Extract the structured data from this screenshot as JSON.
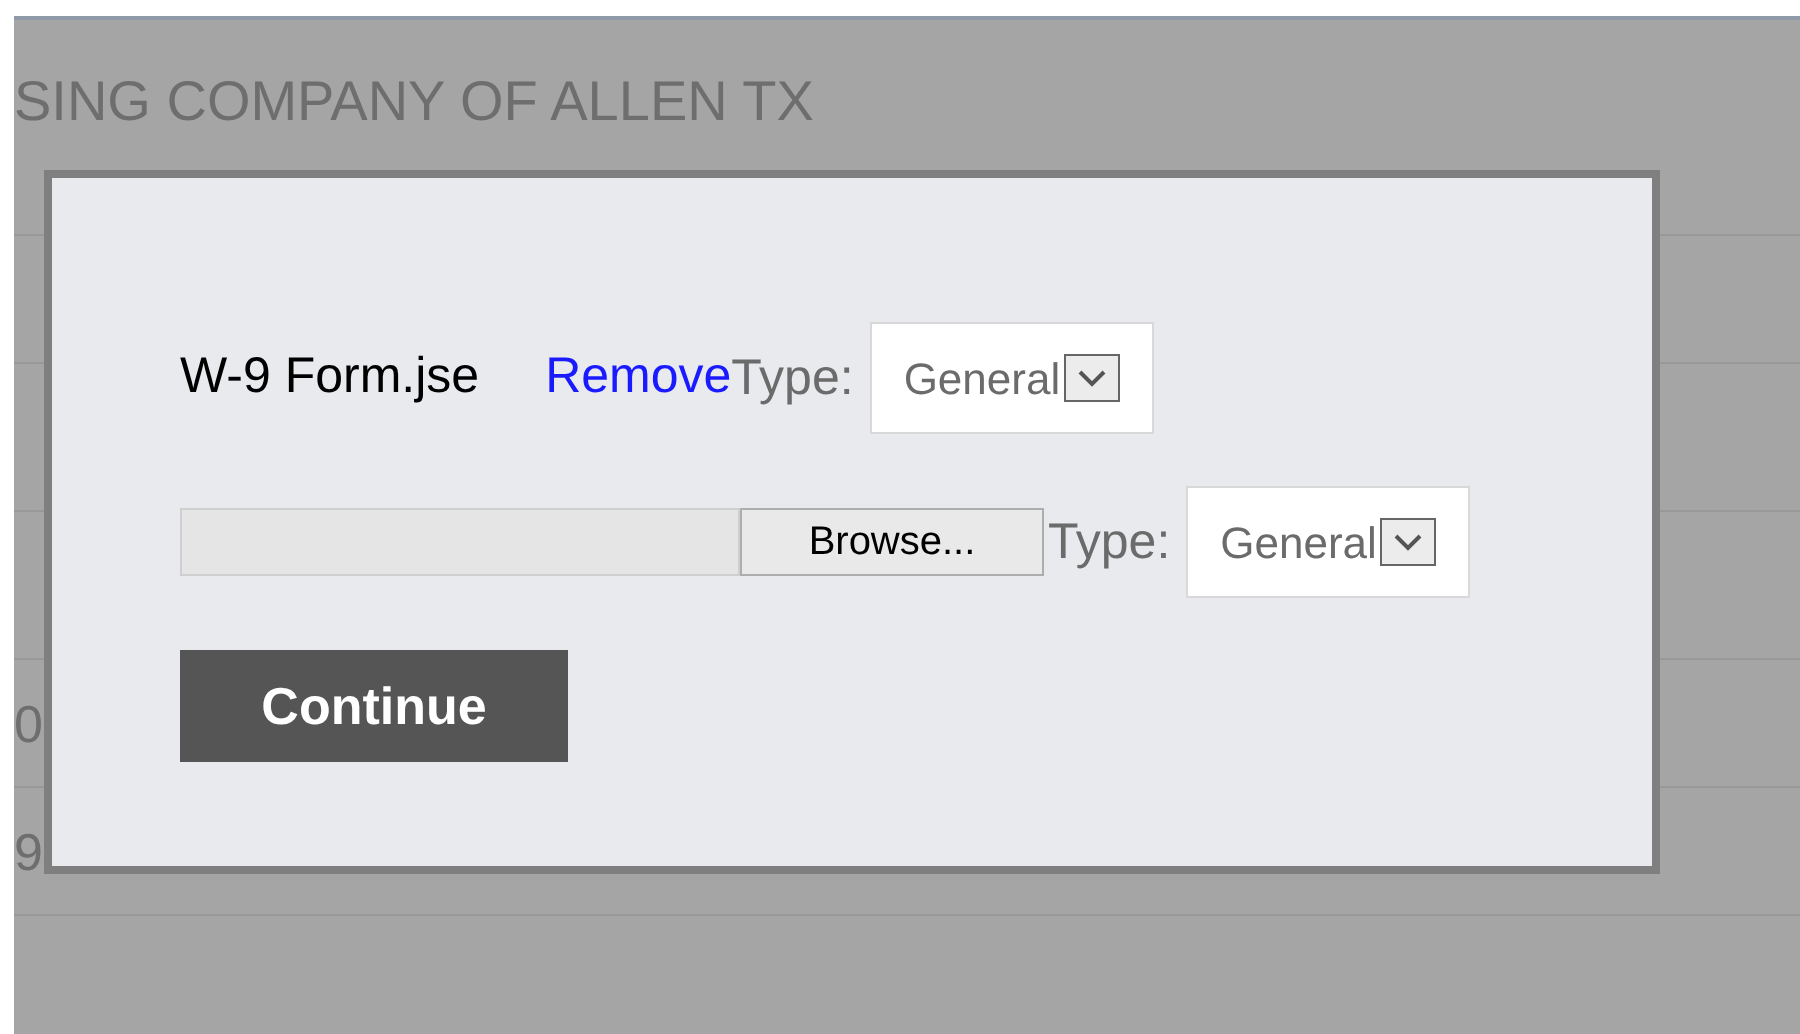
{
  "background": {
    "title": "SING COMPANY OF ALLEN TX",
    "rows": [
      {
        "text": "0"
      },
      {
        "text": "9"
      }
    ]
  },
  "dialog": {
    "attachments": [
      {
        "kind": "existing",
        "file_name": "W-9 Form.jse",
        "remove_link": "Remove",
        "type_label": "Type:",
        "type_value": "General"
      },
      {
        "kind": "upload",
        "browse_button": "Browse...",
        "type_label": "Type:",
        "type_value": "General"
      }
    ],
    "continue_button": "Continue"
  }
}
